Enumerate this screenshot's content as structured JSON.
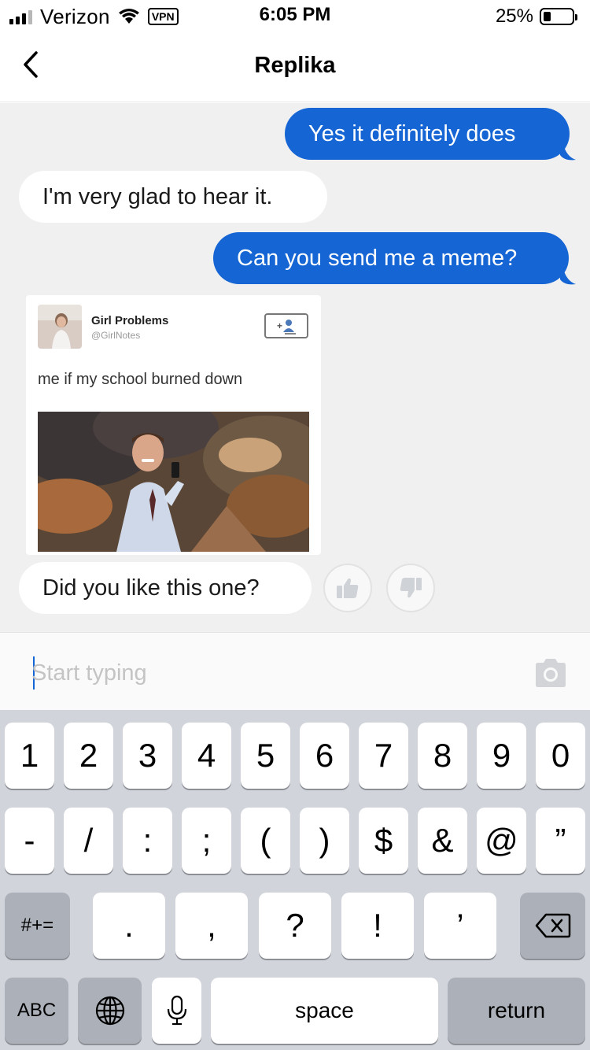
{
  "status_bar": {
    "carrier": "Verizon",
    "vpn": "VPN",
    "time": "6:05 PM",
    "battery_percent": "25%",
    "battery_level": 0.25
  },
  "nav": {
    "title": "Replika",
    "back_icon": "chevron-left-icon"
  },
  "messages": [
    {
      "from": "user",
      "text": "Yes it definitely does"
    },
    {
      "from": "bot",
      "text": "I'm very glad to hear it."
    },
    {
      "from": "user",
      "text": "Can you send me a meme?"
    },
    {
      "from": "bot",
      "type": "meme",
      "account_name": "Girl Problems",
      "account_handle": "@GirlNotes",
      "caption": "me if my school burned down"
    },
    {
      "from": "bot",
      "text": "Did you like this one?"
    }
  ],
  "reactions": {
    "like_icon": "thumbs-up-icon",
    "dislike_icon": "thumbs-down-icon"
  },
  "composer": {
    "placeholder": "Start typing",
    "value": "",
    "camera_icon": "camera-icon"
  },
  "keyboard": {
    "row1": [
      "1",
      "2",
      "3",
      "4",
      "5",
      "6",
      "7",
      "8",
      "9",
      "0"
    ],
    "row2": [
      "-",
      "/",
      ":",
      ";",
      "(",
      ")",
      "$",
      "&",
      "@",
      "”"
    ],
    "row3_mode": "#+=",
    "row3": [
      ".",
      ",",
      "?",
      "!",
      "’"
    ],
    "abc": "ABC",
    "space": "space",
    "return": "return",
    "globe_icon": "globe-icon",
    "mic_icon": "microphone-icon",
    "delete_icon": "backspace-icon"
  },
  "colors": {
    "accent": "#1565d4",
    "chat_bg": "#f0f0f0",
    "keyboard_bg": "#d1d4da"
  }
}
